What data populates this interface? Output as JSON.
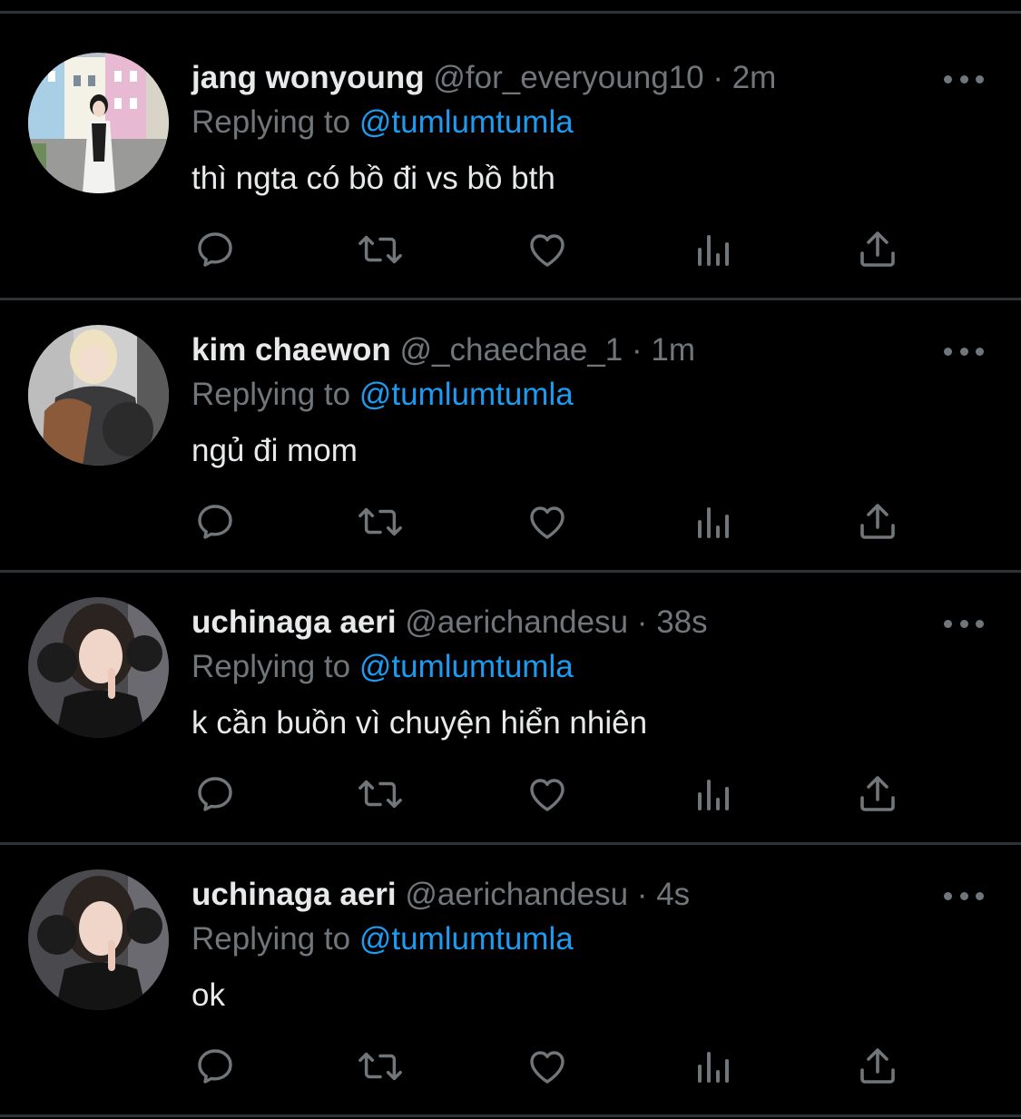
{
  "colors": {
    "background": "#000000",
    "divider": "#2f3336",
    "primary_text": "#e7e9ea",
    "secondary_text": "#71767b",
    "link": "#1d9bf0"
  },
  "separator": "·",
  "more_icon": "more-horizontal-icon",
  "actions": [
    "reply-icon",
    "retweet-icon",
    "like-icon",
    "views-icon",
    "share-icon"
  ],
  "tweets": [
    {
      "display_name": "jang wonyoung",
      "handle": "@for_everyoung10",
      "time": "2m",
      "replying_prefix": "Replying to",
      "replying_to": "@tumlumtumla",
      "text": "thì ngta có bồ đi vs bồ bth"
    },
    {
      "display_name": "kim chaewon",
      "handle": "@_chaechae_1",
      "time": "1m",
      "replying_prefix": "Replying to",
      "replying_to": "@tumlumtumla",
      "text": "ngủ đi mom"
    },
    {
      "display_name": "uchinaga aeri",
      "handle": "@aerichandesu",
      "time": "38s",
      "replying_prefix": "Replying to",
      "replying_to": "@tumlumtumla",
      "text": "k cần buồn vì chuyện hiển nhiên"
    },
    {
      "display_name": "uchinaga aeri",
      "handle": "@aerichandesu",
      "time": "4s",
      "replying_prefix": "Replying to",
      "replying_to": "@tumlumtumla",
      "text": "ok"
    }
  ]
}
